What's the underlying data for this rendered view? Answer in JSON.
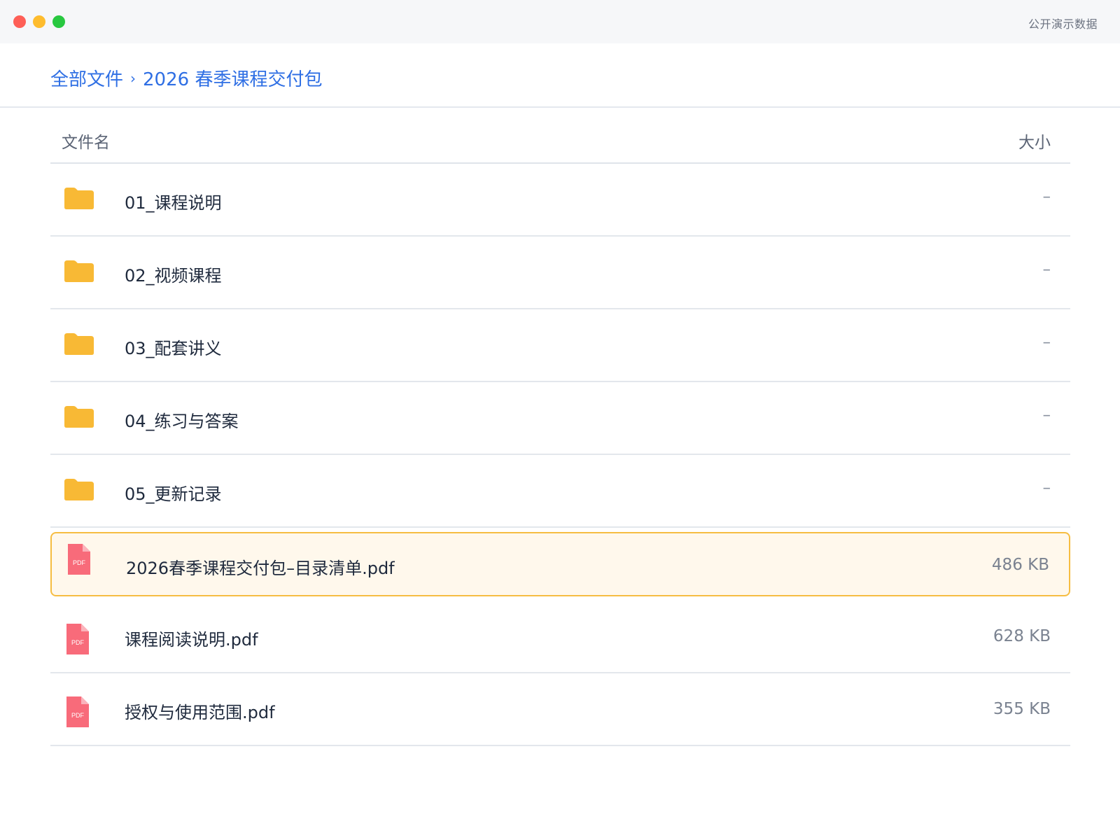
{
  "window": {
    "label": "公开演示数据"
  },
  "breadcrumb": {
    "root": "全部文件",
    "separator": "›",
    "current": "2026 春季课程交付包"
  },
  "table": {
    "headers": {
      "name": "文件名",
      "size": "大小"
    },
    "rows": [
      {
        "type": "folder",
        "icon": "folder-icon",
        "name": "01_课程说明",
        "size": "–"
      },
      {
        "type": "folder",
        "icon": "folder-icon",
        "name": "02_视频课程",
        "size": "–"
      },
      {
        "type": "folder",
        "icon": "folder-icon",
        "name": "03_配套讲义",
        "size": "–"
      },
      {
        "type": "folder",
        "icon": "folder-icon",
        "name": "04_练习与答案",
        "size": "–"
      },
      {
        "type": "folder",
        "icon": "folder-icon",
        "name": "05_更新记录",
        "size": "–"
      },
      {
        "type": "pdf",
        "icon": "pdf-icon",
        "icon_label": "PDF",
        "name": "2026春季课程交付包–目录清单.pdf",
        "size": "486 KB",
        "selected": true
      },
      {
        "type": "pdf",
        "icon": "pdf-icon",
        "icon_label": "PDF",
        "name": "课程阅读说明.pdf",
        "size": "628 KB"
      },
      {
        "type": "pdf",
        "icon": "pdf-icon",
        "icon_label": "PDF",
        "name": "授权与使用范围.pdf",
        "size": "355 KB"
      }
    ]
  },
  "colors": {
    "accent": "#2f6fe4",
    "folder": "#f8b935",
    "pdf": "#f86b7a",
    "selected_border": "#f6bd42",
    "selected_bg": "#fff8ec"
  }
}
